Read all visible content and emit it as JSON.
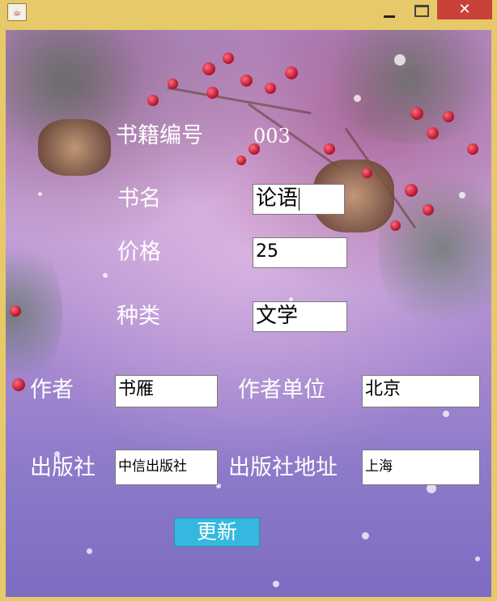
{
  "window": {
    "title_icon": "java-cup-icon",
    "min_glyph": "",
    "max_glyph": "",
    "close_glyph": "✕"
  },
  "form": {
    "book_id_label": "书籍编号",
    "book_id_value": "003",
    "title_label": "书名",
    "title_value": "论语",
    "price_label": "价格",
    "price_value": "25",
    "category_label": "种类",
    "category_value": "文学",
    "author_label": "作者",
    "author_value": "书雁",
    "author_unit_label": "作者单位",
    "author_unit_value": "北京",
    "publisher_label": "出版社",
    "publisher_value": "中信出版社",
    "publisher_address_label": "出版社地址",
    "publisher_address_value": "上海",
    "update_button": "更新"
  },
  "colors": {
    "titlebar": "#e8c96a",
    "close": "#c9423a",
    "button": "#34b8e0"
  }
}
